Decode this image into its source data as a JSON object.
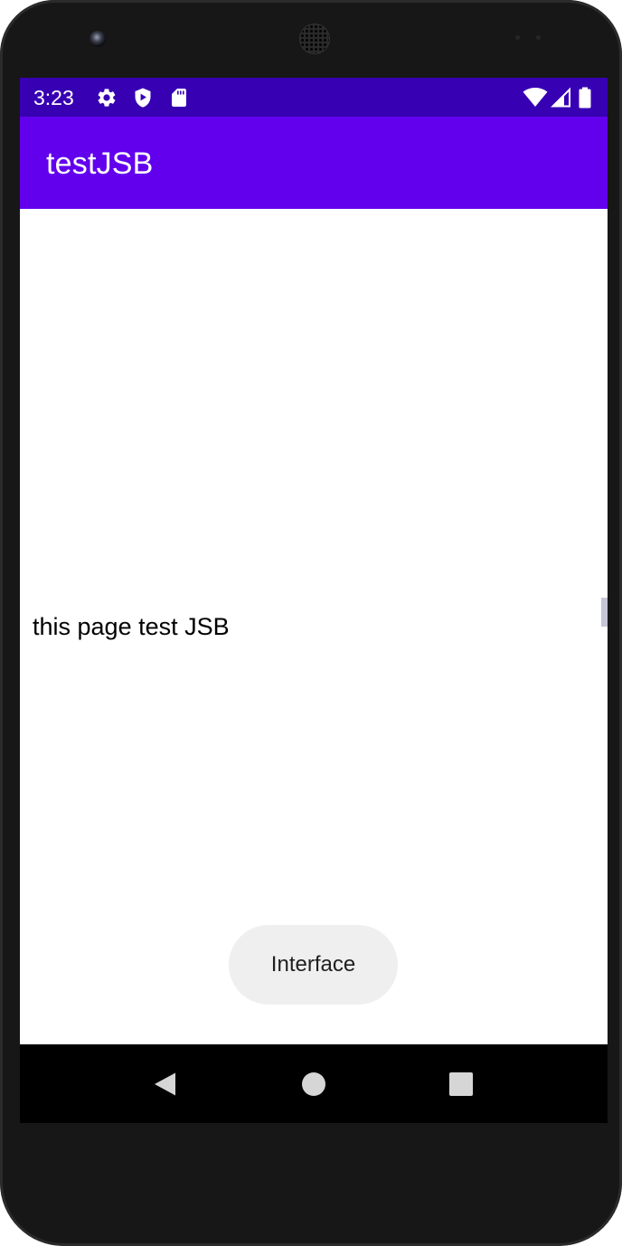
{
  "status_bar": {
    "time": "3:23",
    "left_icons": [
      "gear-icon",
      "shield-play-icon",
      "sd-card-icon"
    ],
    "right_icons": [
      "wifi-icon",
      "cell-signal-icon",
      "battery-icon"
    ],
    "background_color": "#3700b3"
  },
  "app_bar": {
    "title": "testJSB",
    "background_color": "#6200ee"
  },
  "content": {
    "text": "this page test JSB",
    "button_label": "Interface"
  },
  "nav_bar": {
    "buttons": [
      "back-icon",
      "home-icon",
      "recents-icon"
    ]
  }
}
